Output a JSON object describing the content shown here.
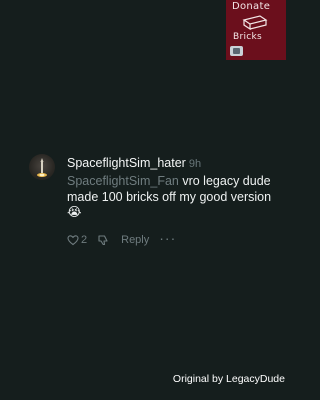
{
  "donate_badge": {
    "line1": "Donate",
    "line2": "Bricks",
    "icon": "brick-icon",
    "thumb_icon": "image-thumbnail-icon",
    "color": "#6b0f1c"
  },
  "comment": {
    "username": "SpaceflightSim_hater",
    "time": "9h",
    "mention": "SpaceflightSim_Fan",
    "text": " vro legacy dude made 100 bricks off my good version",
    "emoji": "😭",
    "likes": "2",
    "reply_label": "Reply",
    "more_label": "···",
    "icons": [
      "heart-icon",
      "dislike-icon",
      "more-icon"
    ]
  },
  "credit": "Original by LegacyDude",
  "colors": {
    "background": "#151e1d",
    "muted_text": "#6f7c7f"
  }
}
